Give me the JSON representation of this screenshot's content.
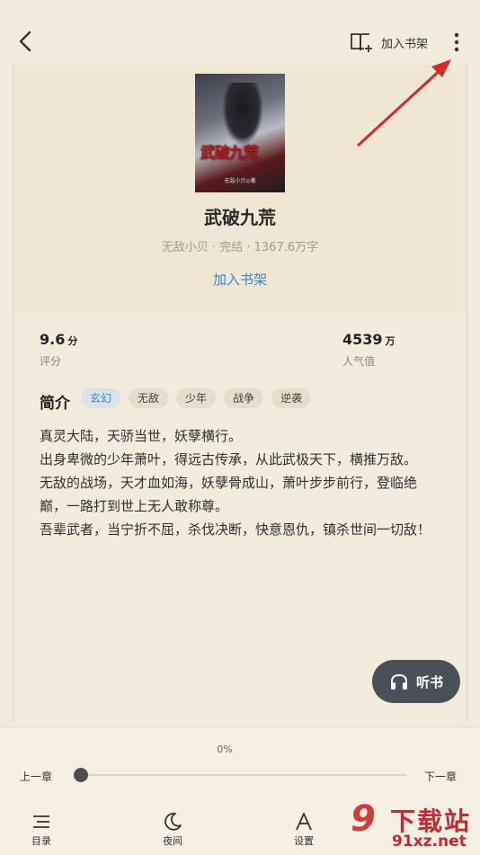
{
  "header": {
    "add_shelf_label": "加入书架"
  },
  "book": {
    "cover_title": "武破九荒",
    "cover_author": "无敌小贝◎著",
    "title": "武破九荒",
    "meta": "无敌小贝 · 完结 · 1367.6万字",
    "add_shelf_link": "加入书架"
  },
  "stats": {
    "score_value": "9.6",
    "score_unit": "分",
    "score_label": "评分",
    "pop_value": "4539",
    "pop_unit": "万",
    "pop_label": "人气值"
  },
  "intro": {
    "heading": "简介",
    "tags": [
      "玄幻",
      "无敌",
      "少年",
      "战争",
      "逆袭"
    ],
    "paragraphs": [
      "真灵大陆，天骄当世，妖孽横行。",
      "出身卑微的少年萧叶，得远古传承，从此武极天下，横推万敌。",
      "无敌的战场，天才血如海，妖孽骨成山，萧叶步步前行，登临绝巅，一路打到世上无人敢称尊。",
      "吾辈武者，当宁折不屈，杀伐决断，快意恩仇，镇杀世间一切敌！"
    ]
  },
  "listen_button": "听书",
  "reader": {
    "progress_text": "0%",
    "progress": 0,
    "prev_chapter": "上一章",
    "next_chapter": "下一章"
  },
  "nav": [
    {
      "label": "目录",
      "icon": "list-icon"
    },
    {
      "label": "夜间",
      "icon": "moon-icon"
    },
    {
      "label": "设置",
      "icon": "font-icon"
    }
  ],
  "watermark": {
    "logo": "9",
    "big": "下载站",
    "small": "91xz.net"
  },
  "colors": {
    "background": "#f3ecdd",
    "link_blue": "#3a86d6",
    "annotation_arrow": "#d42a2a",
    "listen_bg": "#4a5058"
  }
}
